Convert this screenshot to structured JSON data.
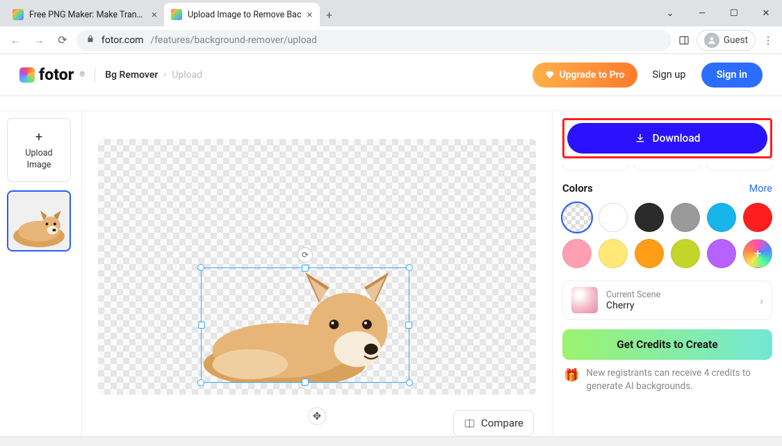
{
  "browser": {
    "tabs": [
      {
        "title": "Free PNG Maker: Make Transp"
      },
      {
        "title": "Upload Image to Remove Bac"
      }
    ],
    "url_host": "fotor.com",
    "url_path": "/features/background-remover/upload",
    "guest_label": "Guest"
  },
  "header": {
    "brand": "fotor",
    "feature": "Bg Remover",
    "crumb": "Upload",
    "upgrade": "Upgrade to Pro",
    "signup": "Sign up",
    "signin": "Sign in"
  },
  "left": {
    "upload_line1": "Upload",
    "upload_line2": "Image"
  },
  "canvas": {
    "compare": "Compare"
  },
  "right": {
    "download": "Download",
    "colors_title": "Colors",
    "more": "More",
    "swatches": [
      "transparent",
      "#ffffff",
      "#2b2b2b",
      "#9a9a9a",
      "#17b5ea",
      "#ff1e1e",
      "#ff9fb1",
      "#ffe877",
      "#ff9d17",
      "#c4d52a",
      "#b761ff",
      "plus"
    ],
    "scene_label": "Current Scene",
    "scene_value": "Cherry",
    "credits": "Get Credits to Create",
    "promo": "New registrants can receive 4 credits to generate AI backgrounds."
  }
}
